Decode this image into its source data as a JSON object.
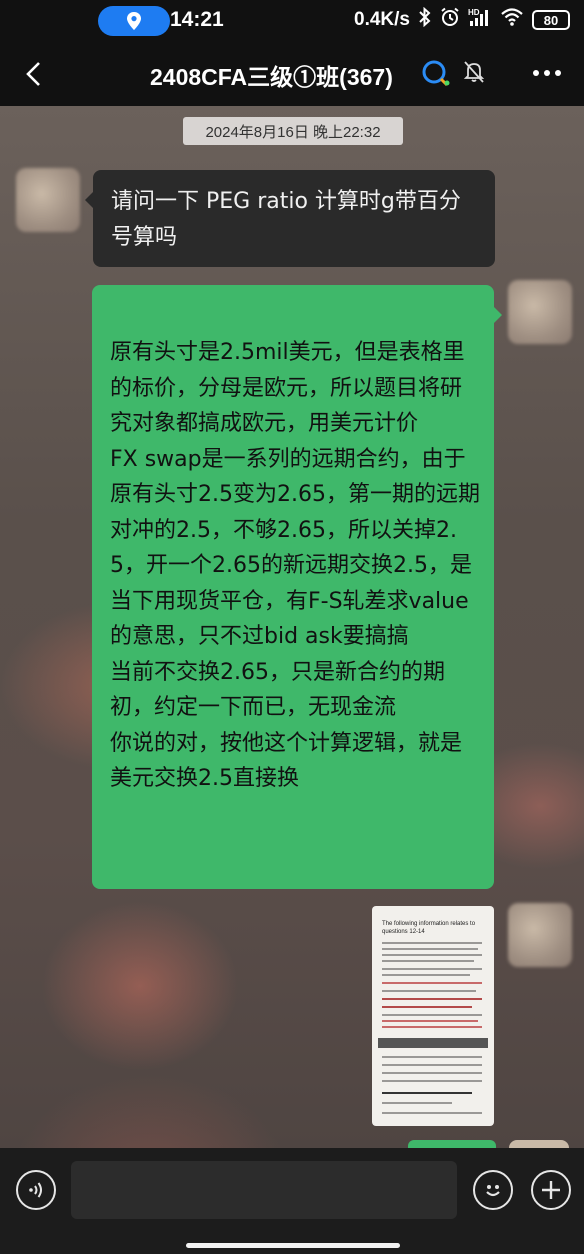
{
  "status_bar": {
    "time": "14:21",
    "net_speed": "0.4K/s",
    "network": "HD",
    "battery": "80"
  },
  "header": {
    "title": "2408CFA三级①班(367)"
  },
  "chat": {
    "timestamp": "2024年8月16日 晚上22:32",
    "messages": [
      {
        "side": "left",
        "text": "请问一下 PEG ratio 计算时g带百分号算吗"
      },
      {
        "side": "right",
        "paragraphs": [
          "原有头寸是2.5mil美元，但是表格里的标价，分母是欧元，所以题目将研究对象都搞成欧元，用美元计价",
          "FX swap是一系列的远期合约，由于原有头寸2.5变为2.65，第一期的远期对冲的2.5，不够2.65，所以关掉2.5，开一个2.65的新远期交换2.5，是当下用现货平仓，有F-S轧差求value的意思，只不过bid ask要搞搞",
          "当前不交换2.65，只是新合约的期初，约定一下而已，无现金流",
          "你说的对，按他这个计算逻辑，就是美元交换2.5直接换"
        ]
      },
      {
        "side": "right",
        "type": "image",
        "caption": "The following information relates to questions 12-14"
      }
    ]
  },
  "input_bar": {
    "placeholder": ""
  },
  "icons": {
    "location": "location-pin-icon",
    "back": "back-arrow-icon",
    "ai": "ai-assistant-icon",
    "mute": "mute-bell-icon",
    "more": "more-dots-icon",
    "voice": "voice-icon",
    "emoji": "emoji-icon",
    "plus": "plus-icon"
  },
  "colors": {
    "self_bubble": "#3fb86a",
    "other_bubble": "#2a2a2a",
    "location_pill": "#1e7cf2"
  }
}
